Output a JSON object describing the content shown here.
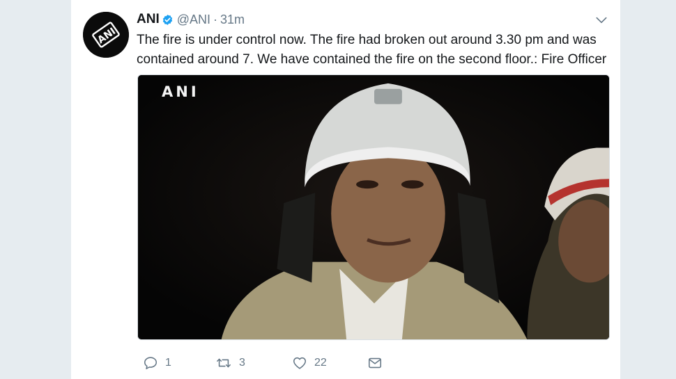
{
  "tweet": {
    "author_name": "ANI",
    "handle": "@ANI",
    "separator": "·",
    "time": "31m",
    "text_lines": [
      "The fire is under control now. The fire had broken out around 3.30 pm and was",
      "contained around 7. We have contained the fire on the second floor.: Fire Officer"
    ],
    "media": {
      "watermark": "ANI",
      "description_icon": "video-still-icon"
    },
    "actions": {
      "reply_count": "1",
      "retweet_count": "3",
      "like_count": "22"
    }
  },
  "icons": {
    "avatar": "ani-logo-icon",
    "verified": "verified-badge-icon",
    "caret": "chevron-down-icon",
    "reply": "reply-icon",
    "retweet": "retweet-icon",
    "like": "heart-icon",
    "message": "envelope-icon"
  },
  "colors": {
    "page_background": "#e6ecf0",
    "card_background": "#ffffff",
    "verified_blue": "#1da1f2",
    "secondary_text": "#657786",
    "primary_text": "#14171a"
  }
}
